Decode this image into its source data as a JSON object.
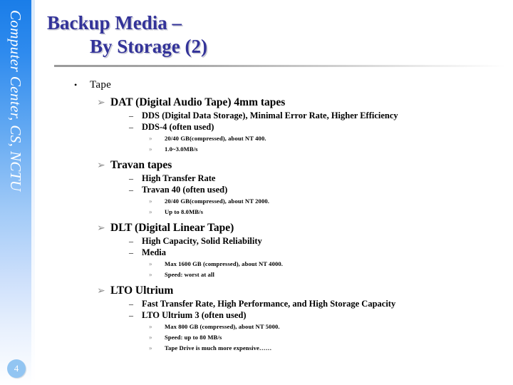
{
  "slide": {
    "sidebar_text": "Computer Center, CS, NCTU",
    "page_number": "4",
    "title_line1": "Backup Media –",
    "title_line2": "By Storage (2)",
    "accent_color": "#333399",
    "sidebar_top_color": "#1a7de8",
    "badge_color": "#92c5f2",
    "marker_level1": "•",
    "marker_level2": "➢",
    "marker_level3": "–",
    "marker_level4": "»"
  },
  "content": {
    "level1_label": "Tape",
    "sections": [
      {
        "heading": "DAT  (Digital Audio Tape) 4mm tapes",
        "items": [
          {
            "text": "DDS (Digital Data Storage), Minimal Error Rate, Higher Efficiency",
            "notes": []
          },
          {
            "text": "DDS-4 (often used)",
            "notes": [
              "20/40 GB(compressed), about NT 400.",
              "1.0~3.0MB/s"
            ]
          }
        ]
      },
      {
        "heading": "Travan tapes",
        "items": [
          {
            "text": "High Transfer Rate",
            "notes": []
          },
          {
            "text": "Travan 40 (often used)",
            "notes": [
              "20/40 GB(compressed), about NT 2000.",
              "Up to 8.0MB/s"
            ]
          }
        ]
      },
      {
        "heading": "DLT  (Digital Linear Tape)",
        "items": [
          {
            "text": "High Capacity, Solid Reliability",
            "notes": []
          },
          {
            "text": "Media",
            "notes": [
              "Max 1600 GB (compressed), about NT 4000.",
              "Speed: worst at all"
            ]
          }
        ]
      },
      {
        "heading": "LTO Ultrium",
        "items": [
          {
            "text": "Fast Transfer Rate, High Performance, and High Storage Capacity",
            "notes": []
          },
          {
            "text": "LTO Ultrium 3 (often used)",
            "notes": [
              "Max 800 GB (compressed), about NT 5000.",
              "Speed: up to 80 MB/s",
              "Tape Drive is much more expensive……"
            ]
          }
        ]
      }
    ]
  }
}
